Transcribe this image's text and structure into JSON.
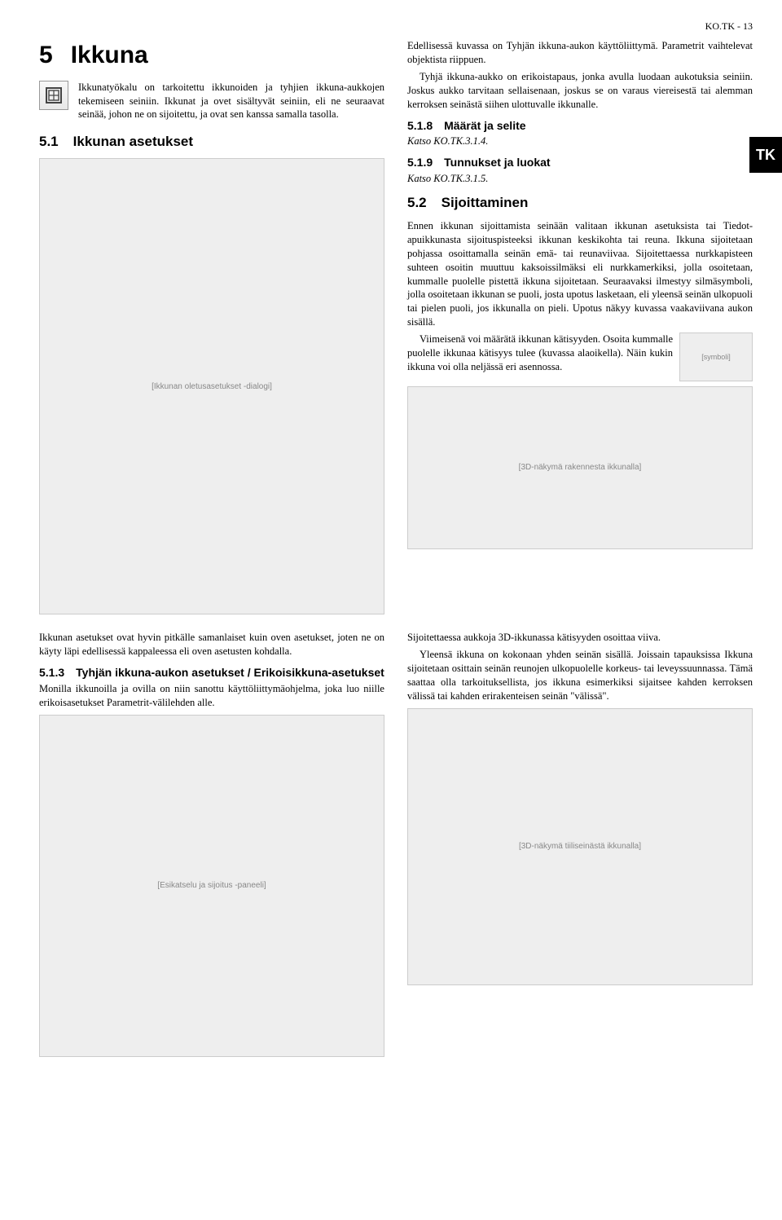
{
  "header": {
    "page_label": "KO.TK - 13"
  },
  "side_tab": "TK",
  "chapter": {
    "num": "5",
    "title": "Ikkuna"
  },
  "intro": "Ikkunatyökalu on tarkoitettu ikkunoiden ja tyhjien ikkuna-aukkojen tekemiseen seiniin. Ikkunat ja ovet sisältyvät seiniin, eli ne seuraavat seinää, johon ne on sijoitettu, ja ovat sen kanssa samalla tasolla.",
  "s5_1": {
    "num": "5.1",
    "title": "Ikkunan asetukset"
  },
  "fig_main": "[Ikkunan oletusasetukset -dialogi]",
  "col2_intro_p1": "Edellisessä kuvassa on Tyhjän ikkuna-aukon käyttöliittymä. Parametrit vaihtelevat objektista riippuen.",
  "col2_intro_p2": "Tyhjä ikkuna-aukko on erikoistapaus, jonka avulla luodaan aukotuksia seiniin. Joskus aukko tarvitaan sellaisenaan, joskus se on varaus viereisestä tai alemman kerroksen seinästä siihen ulottuvalle ikkunalle.",
  "s5_1_8": {
    "num": "5.1.8",
    "title": "Määrät ja selite",
    "body": "Katso KO.TK.3.1.4."
  },
  "s5_1_9": {
    "num": "5.1.9",
    "title": "Tunnukset ja luokat",
    "body": "Katso KO.TK.3.1.5."
  },
  "s5_2": {
    "num": "5.2",
    "title": "Sijoittaminen",
    "p1": "Ennen ikkunan sijoittamista seinään valitaan ikkunan asetuksista tai Tiedot-apuikkunasta sijoituspisteeksi ikkunan keskikohta tai reuna. Ikkuna sijoitetaan pohjassa osoittamalla seinän emä- tai reunaviivaa. Sijoitettaessa nurkkapisteen suhteen osoitin muuttuu kaksoissilmäksi eli nurkkamerkiksi, jolla osoitetaan, kummalle puolelle pistettä ikkuna sijoitetaan. Seuraavaksi ilmestyy silmäsymboli, jolla osoitetaan ikkunan se puoli, josta upotus lasketaan, eli yleensä seinän ulkopuoli tai pielen puoli, jos ikkunalla on pieli. Upotus näkyy kuvassa vaakaviivana aukon sisällä.",
    "p2": "Viimeisenä voi määrätä ikkunan kätisyyden. Osoita kummalle puolelle ikkunaa kätisyys tulee (kuvassa alaoikella). Näin kukin ikkuna voi olla neljässä eri asennossa.",
    "inline_fig": "[symboli]"
  },
  "fig_3d": "[3D-näkymä rakennesta ikkunalla]",
  "bottom_left": {
    "p1": "Ikkunan asetukset ovat hyvin pitkälle samanlaiset kuin oven asetukset, joten ne on käyty läpi edellisessä kappaleessa eli oven asetusten kohdalla.",
    "s5_1_3": {
      "num": "5.1.3",
      "title": "Tyhjän ikkuna-aukon asetukset / Erikoisikkuna-asetukset",
      "body": "Monilla ikkunoilla ja ovilla on niin sanottu käyttöliittymäohjelma, joka luo niille erikoisasetukset Parametrit-välilehden alle."
    },
    "fig": "[Esikatselu ja sijoitus -paneeli]"
  },
  "bottom_right": {
    "p1": "Sijoitettaessa aukkoja 3D-ikkunassa kätisyyden osoittaa viiva.",
    "p2": "Yleensä ikkuna on kokonaan yhden seinän sisällä. Joissain tapauksissa Ikkuna sijoitetaan osittain seinän reunojen ulkopuolelle korkeus- tai leveyssuunnassa. Tämä saattaa olla tarkoituksellista, jos ikkuna esimerkiksi sijaitsee kahden kerroksen välissä tai kahden erirakenteisen seinän \"välissä\".",
    "fig": "[3D-näkymä tiiliseinästä ikkunalla]"
  }
}
